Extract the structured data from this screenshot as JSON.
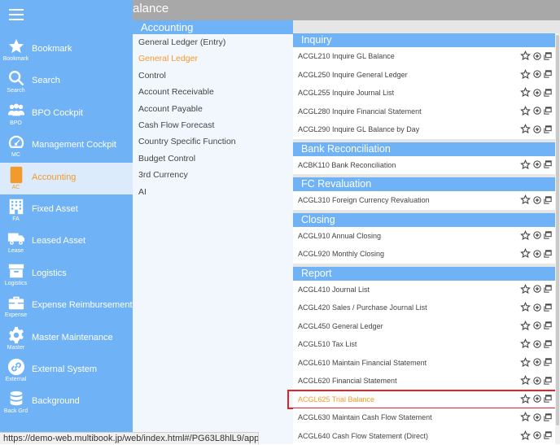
{
  "topbar": {
    "title": "alance"
  },
  "sidebar": {
    "items": [
      {
        "id": "bookmark",
        "label": "Bookmark",
        "abbr": "Bookmark",
        "icon": "star-icon"
      },
      {
        "id": "search",
        "label": "Search",
        "abbr": "Search",
        "icon": "search-icon"
      },
      {
        "id": "bpo",
        "label": "BPO Cockpit",
        "abbr": "BPO",
        "icon": "people-icon"
      },
      {
        "id": "mc",
        "label": "Management Cockpit",
        "abbr": "MC",
        "icon": "gauge-icon"
      },
      {
        "id": "ac",
        "label": "Accounting",
        "abbr": "AC",
        "icon": "calculator-icon",
        "active": true
      },
      {
        "id": "fa",
        "label": "Fixed Asset",
        "abbr": "FA",
        "icon": "building-icon"
      },
      {
        "id": "lease",
        "label": "Leased Asset",
        "abbr": "Lease",
        "icon": "truck-icon"
      },
      {
        "id": "logistics",
        "label": "Logistics",
        "abbr": "Logistics",
        "icon": "box-icon"
      },
      {
        "id": "expense",
        "label": "Expense Reimbursement",
        "abbr": "Expense",
        "icon": "briefcase-icon"
      },
      {
        "id": "master",
        "label": "Master Maintenance",
        "abbr": "Master",
        "icon": "gear-icon"
      },
      {
        "id": "external",
        "label": "External System",
        "abbr": "External",
        "icon": "link-icon"
      },
      {
        "id": "background",
        "label": "Background",
        "abbr": "Back Grd",
        "icon": "database-icon"
      }
    ]
  },
  "submenu": {
    "title": "Accounting",
    "items": [
      {
        "label": "General Ledger (Entry)"
      },
      {
        "label": "General Ledger",
        "active": true
      },
      {
        "label": "Control"
      },
      {
        "label": "Account Receivable"
      },
      {
        "label": "Account Payable"
      },
      {
        "label": "Cash Flow Forecast"
      },
      {
        "label": "Country Specific Function"
      },
      {
        "label": "Budget Control"
      },
      {
        "label": "3rd Currency"
      },
      {
        "label": "AI"
      }
    ]
  },
  "sections": [
    {
      "title": "Inquiry",
      "rows": [
        {
          "label": "ACGL210 Inquire GL Balance"
        },
        {
          "label": "ACGL250 Inquire General Ledger"
        },
        {
          "label": "ACGL255 Inquire Journal List"
        },
        {
          "label": "ACGL280 Inquire Financial Statement"
        },
        {
          "label": "ACGL290 Inquire GL Balance by Day"
        }
      ]
    },
    {
      "title": "Bank Reconciliation",
      "rows": [
        {
          "label": "ACBK110 Bank Reconciliation"
        }
      ]
    },
    {
      "title": "FC Revaluation",
      "rows": [
        {
          "label": "ACGL310 Foreign Currency Revaluation"
        }
      ]
    },
    {
      "title": "Closing",
      "rows": [
        {
          "label": "ACGL910 Annual Closing"
        },
        {
          "label": "ACGL920 Monthly Closing"
        }
      ]
    },
    {
      "title": "Report",
      "rows": [
        {
          "label": "ACGL410 Journal List"
        },
        {
          "label": "ACGL420 Sales / Purchase Journal List"
        },
        {
          "label": "ACGL450 General Ledger"
        },
        {
          "label": "ACGL510 Tax List"
        },
        {
          "label": "ACGL610 Maintain Financial Statement"
        },
        {
          "label": "ACGL620 Financial Statement"
        },
        {
          "label": "ACGL625 Trial Balance",
          "highlighted": true
        },
        {
          "label": "ACGL630 Maintain Cash Flow Statement"
        },
        {
          "label": "ACGL640 Cash Flow Statement (Direct)"
        }
      ]
    }
  ],
  "row_icons": [
    "star-outline-icon",
    "add-circle-icon",
    "new-window-icon"
  ],
  "statusbar": {
    "url": "https://demo-web.multibook.jp/web/index.html#/PG63L8hlL9/app"
  },
  "colors": {
    "sidebar": "#6fb2f5",
    "accent": "#f39b2a",
    "highlight_border": "#e3222a"
  }
}
